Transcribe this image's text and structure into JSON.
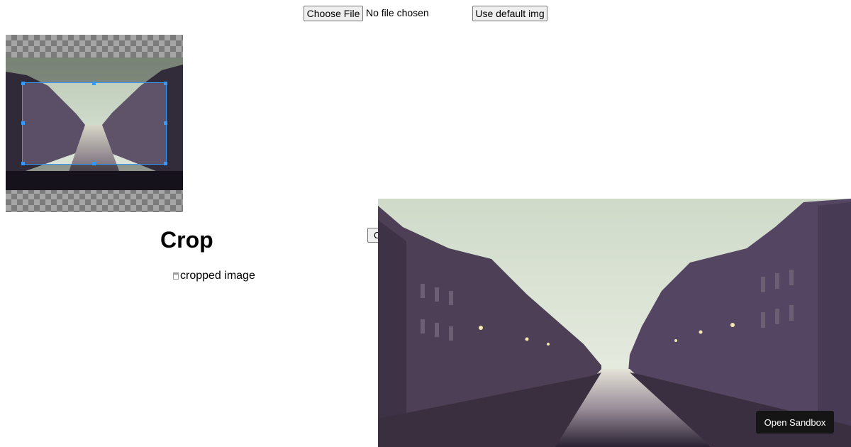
{
  "toolbar": {
    "choose_file_label": "Choose File",
    "file_status": "No file chosen",
    "default_img_label": "Use default img"
  },
  "preview": {
    "title": "Crop",
    "cropped_alt": "cropped image",
    "crop_button_label": "Crop"
  },
  "sandbox": {
    "label": "Open Sandbox"
  },
  "colors": {
    "crop_outline": "#3399ff",
    "button_face": "#efefef",
    "sandbox_bg": "#151515"
  }
}
